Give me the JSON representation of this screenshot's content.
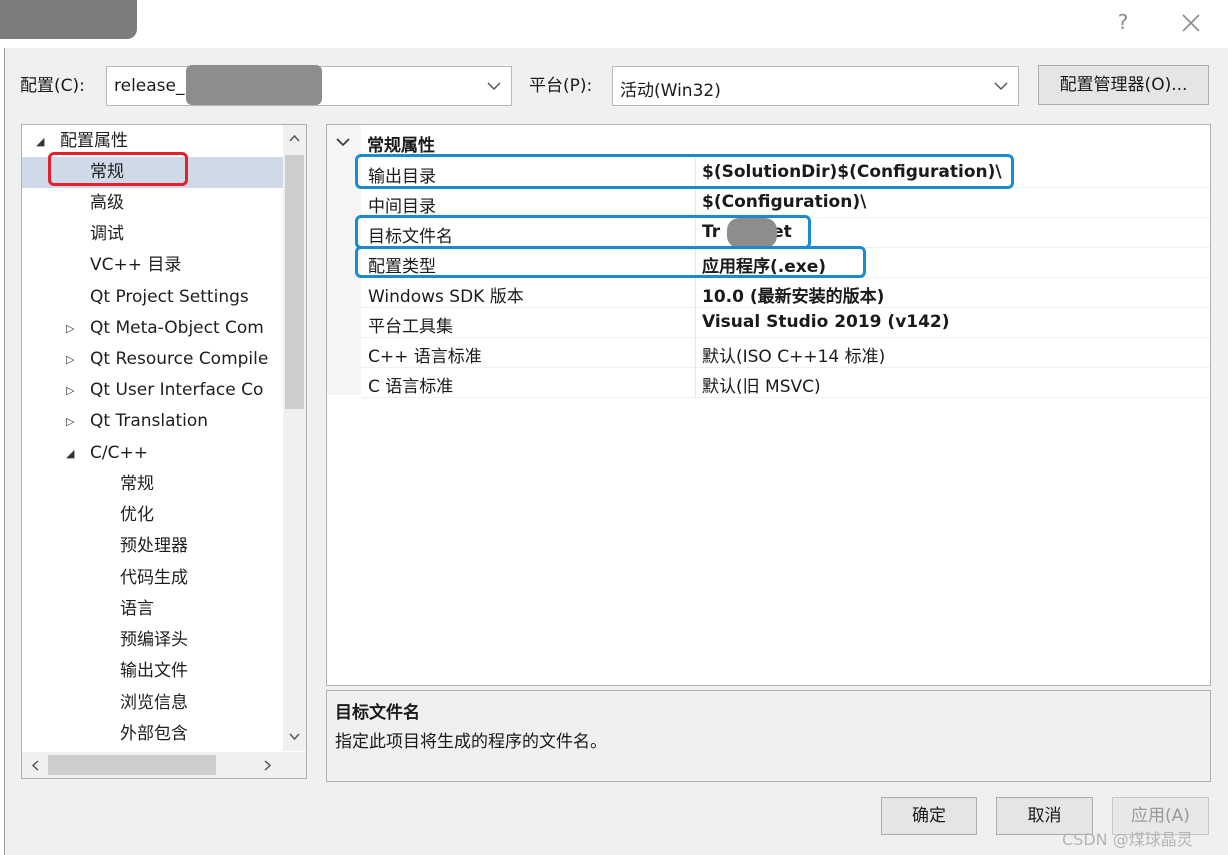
{
  "window": {
    "help_icon": "?",
    "close_icon": "close-x"
  },
  "toolbar": {
    "config_label": "配置(C):",
    "config_value": "release_",
    "platform_label": "平台(P):",
    "platform_value": "活动(Win32)",
    "config_manager_label": "配置管理器(O)..."
  },
  "tree": {
    "root_label": "配置属性",
    "items": [
      {
        "label": "常规"
      },
      {
        "label": "高级"
      },
      {
        "label": "调试"
      },
      {
        "label": "VC++ 目录"
      },
      {
        "label": "Qt Project Settings"
      },
      {
        "label": "Qt Meta-Object Com"
      },
      {
        "label": "Qt Resource Compile"
      },
      {
        "label": "Qt User Interface Co"
      },
      {
        "label": "Qt Translation"
      },
      {
        "label": "C/C++"
      }
    ],
    "cpp_children": [
      {
        "label": "常规"
      },
      {
        "label": "优化"
      },
      {
        "label": "预处理器"
      },
      {
        "label": "代码生成"
      },
      {
        "label": "语言"
      },
      {
        "label": "预编译头"
      },
      {
        "label": "输出文件"
      },
      {
        "label": "浏览信息"
      },
      {
        "label": "外部包含"
      }
    ],
    "selected_index": 0
  },
  "grid": {
    "section_title": "常规属性",
    "rows": [
      {
        "name": "输出目录",
        "value": "$(SolutionDir)$(Configuration)\\",
        "bold": true
      },
      {
        "name": "中间目录",
        "value": "$(Configuration)\\",
        "bold": true
      },
      {
        "name": "目标文件名",
        "value_prefix": "Tr",
        "value_suffix": "et",
        "bold": true
      },
      {
        "name": "配置类型",
        "value": "应用程序(.exe)",
        "bold": true
      },
      {
        "name": "Windows SDK 版本",
        "value": "10.0 (最新安装的版本)",
        "bold": true
      },
      {
        "name": "平台工具集",
        "value": "Visual Studio 2019 (v142)",
        "bold": true
      },
      {
        "name": "C++ 语言标准",
        "value": "默认(ISO C++14 标准)",
        "bold": false
      },
      {
        "name": "C 语言标准",
        "value": "默认(旧 MSVC)",
        "bold": false
      }
    ]
  },
  "description": {
    "title": "目标文件名",
    "text": "指定此项目将生成的程序的文件名。"
  },
  "buttons": {
    "ok": "确定",
    "cancel": "取消",
    "apply": "应用(A)"
  },
  "watermark": "CSDN @煤球晶灵",
  "colors": {
    "highlight_red": "#e5202a",
    "highlight_blue": "#1b8bcf",
    "selection": "#cfd9e8"
  }
}
